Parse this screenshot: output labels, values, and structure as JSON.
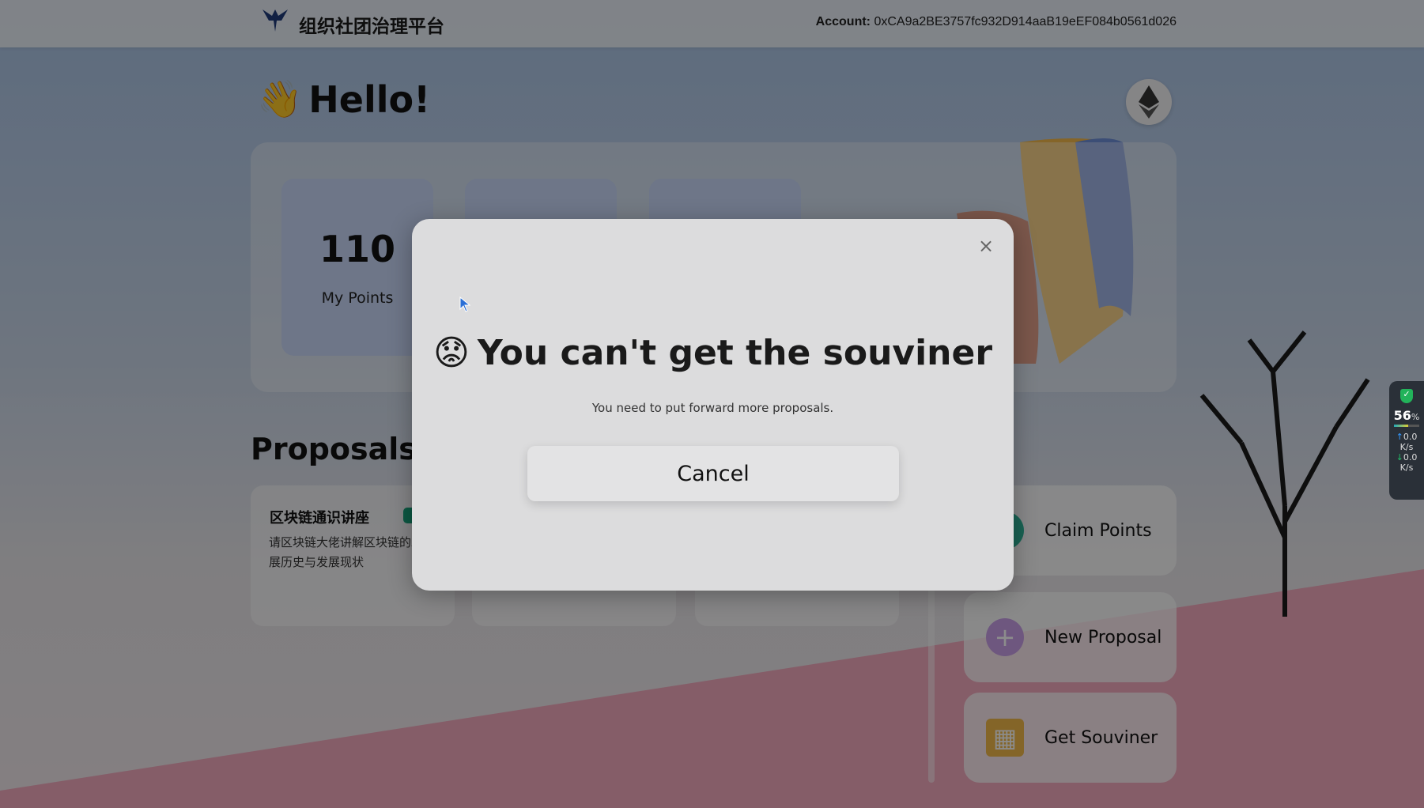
{
  "header": {
    "site_title": "组织社团治理平台",
    "account_label": "Account:",
    "account_address": "0xCA9a2BE3757fc932D914aaB19eEF084b0561d026"
  },
  "greeting": {
    "emoji": "👋",
    "text": "Hello!"
  },
  "stats": {
    "points_value": "110",
    "points_label": "My Points"
  },
  "proposals": {
    "heading": "Proposals",
    "items": [
      {
        "title": "区块链通识讲座",
        "description": "请区块链大佬讲解区块链的发展历史与发展现状"
      }
    ]
  },
  "actions": {
    "claim": "Claim Points",
    "new_proposal": "New Proposal",
    "souvenir": "Get Souviner"
  },
  "widget": {
    "percent": "56",
    "percent_unit": "%",
    "up": "0.0",
    "up_unit": "K/s",
    "down": "0.0",
    "down_unit": "K/s"
  },
  "modal": {
    "emoji": "😟",
    "title": "You can't get the souviner",
    "message": "You need to put forward more proposals.",
    "cancel_label": "Cancel",
    "close_symbol": "×"
  },
  "colors": {
    "badge": "#16a07a",
    "card": "#c8d7f7"
  }
}
